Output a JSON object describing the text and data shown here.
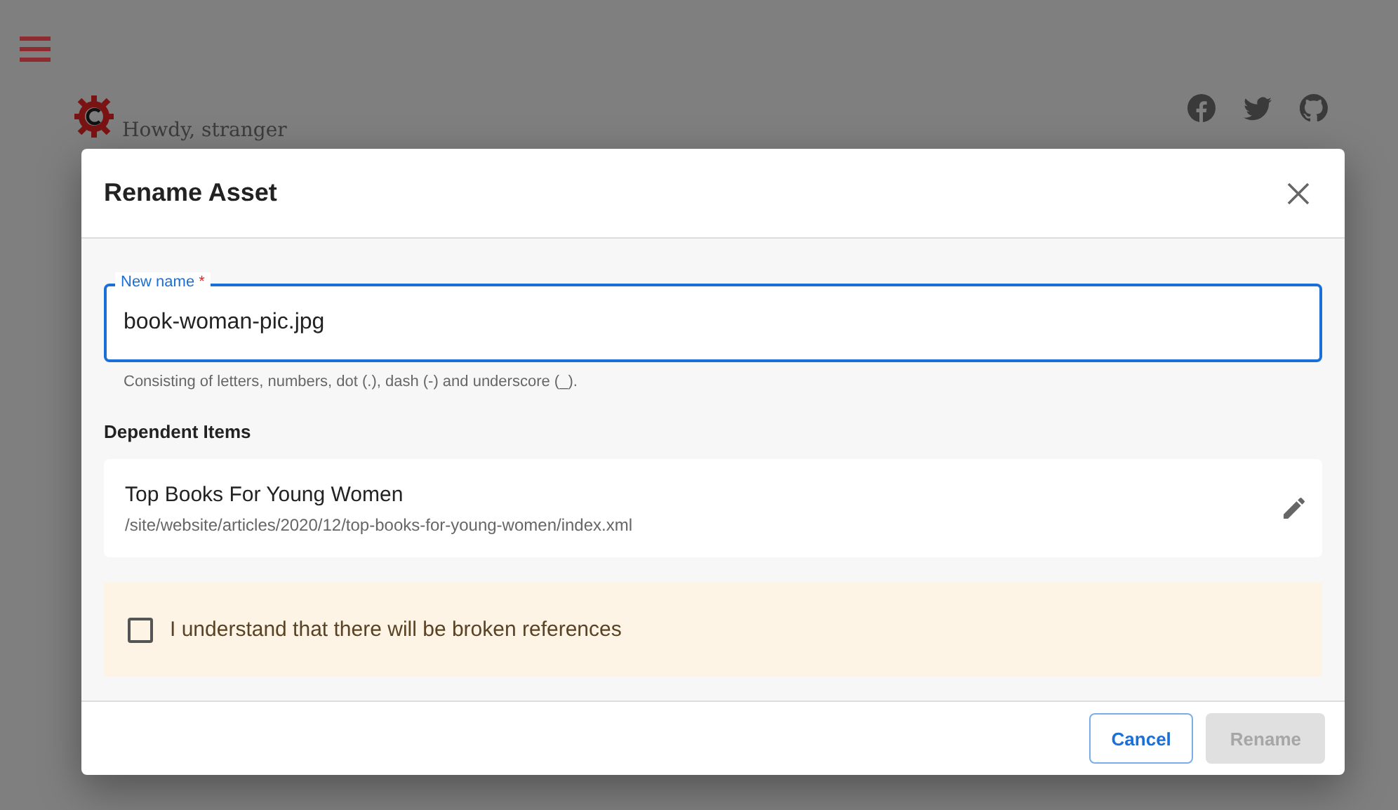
{
  "page": {
    "greeting": "Howdy, stranger"
  },
  "dialog": {
    "title": "Rename Asset",
    "field": {
      "label": "New name",
      "required_mark": "*",
      "value": "book-woman-pic.jpg",
      "focused": true,
      "helper": "Consisting of letters, numbers, dot (.), dash (-) and underscore (_)."
    },
    "section_title": "Dependent Items",
    "dependent_items": [
      {
        "title": "Top Books For Young Women",
        "path": "/site/website/articles/2020/12/top-books-for-young-women/index.xml"
      }
    ],
    "confirmation": {
      "label": "I understand that there will be broken references",
      "checked": false
    },
    "buttons": [
      {
        "label": "Cancel",
        "kind": "outlined",
        "disabled": false
      },
      {
        "label": "Rename",
        "kind": "contained",
        "disabled": true
      }
    ]
  }
}
